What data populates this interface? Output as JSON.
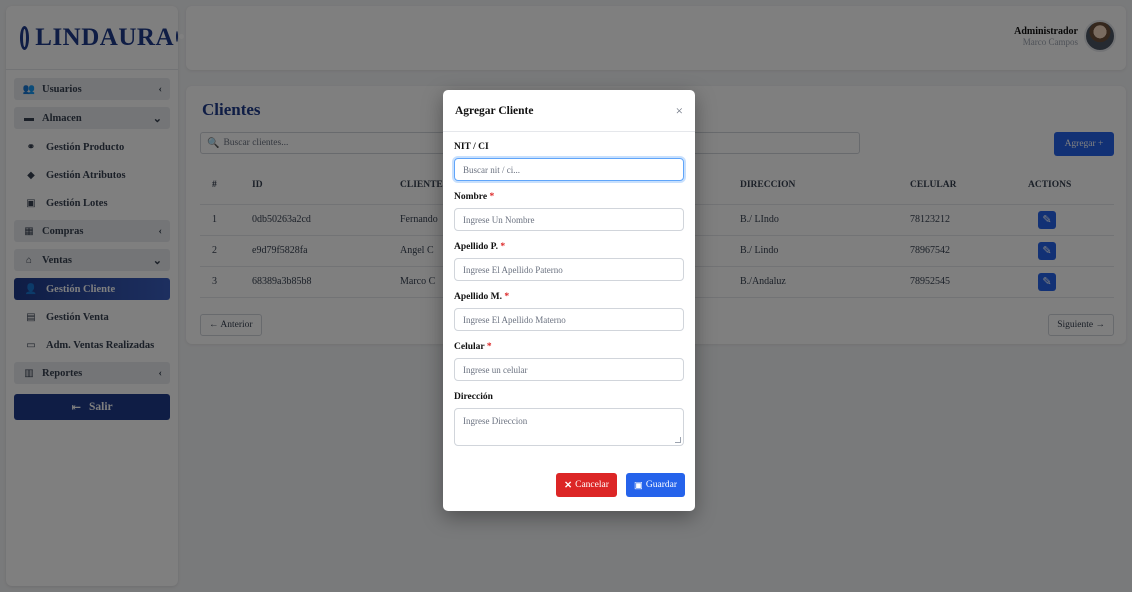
{
  "brand": {
    "name": "LINDAURA"
  },
  "user": {
    "role": "Administrador",
    "name": "Marco Campos"
  },
  "sidebar": {
    "groups": [
      {
        "label": "Usuarios",
        "icon": "users-cog-icon"
      },
      {
        "label": "Almacen",
        "icon": "box-icon"
      },
      {
        "label": "Compras",
        "icon": "cart-icon"
      },
      {
        "label": "Ventas",
        "icon": "store-icon"
      },
      {
        "label": "Reportes",
        "icon": "report-icon"
      }
    ],
    "almacen_items": [
      {
        "label": "Gestión Producto",
        "icon": "products-icon"
      },
      {
        "label": "Gestión Atributos",
        "icon": "tags-icon"
      },
      {
        "label": "Gestión Lotes",
        "icon": "cubes-icon"
      }
    ],
    "ventas_items": [
      {
        "label": "Gestión Cliente",
        "icon": "client-icon"
      },
      {
        "label": "Gestión Venta",
        "icon": "cash-register-icon"
      },
      {
        "label": "Adm. Ventas Realizadas",
        "icon": "money-icon"
      }
    ],
    "logout_label": "Salir"
  },
  "main": {
    "title": "Clientes",
    "search_placeholder": "Buscar clientes...",
    "add_label": "Agregar +",
    "columns": [
      "#",
      "ID",
      "CLIENTE",
      "DIRECCION",
      "CELULAR",
      "ACTIONS"
    ],
    "rows": [
      {
        "n": "1",
        "id": "0db50263a2cd",
        "cliente": "Fernando",
        "direccion": "B./ LIndo",
        "celular": "78123212"
      },
      {
        "n": "2",
        "id": "e9d79f5828fa",
        "cliente": "Angel C",
        "direccion": "B./ Lindo",
        "celular": "78967542"
      },
      {
        "n": "3",
        "id": "68389a3b85b8",
        "cliente": "Marco C",
        "direccion": "B./Andaluz",
        "celular": "78952545"
      }
    ],
    "prev_label": "← Anterior",
    "next_label": "Siguiente →"
  },
  "modal": {
    "title": "Agregar Cliente",
    "close": "×",
    "fields": {
      "nit_label": "NIT / CI",
      "nit_placeholder": "Buscar nit / ci...",
      "nombre_label": "Nombre",
      "nombre_placeholder": "Ingrese Un Nombre",
      "apellido_p_label": "Apellido P.",
      "apellido_p_placeholder": "Ingrese El Apellido Paterno",
      "apellido_m_label": "Apellido M.",
      "apellido_m_placeholder": "Ingrese El Apellido Materno",
      "celular_label": "Celular",
      "celular_placeholder": "Ingrese un celular",
      "direccion_label": "Dirección",
      "direccion_placeholder": "Ingrese Direccion",
      "required_mark": "*"
    },
    "cancel_label": "Cancelar",
    "save_label": "Guardar"
  }
}
